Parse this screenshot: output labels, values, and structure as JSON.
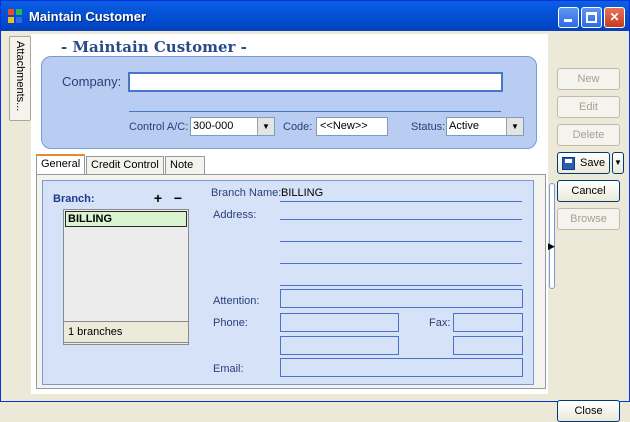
{
  "window": {
    "title": "Maintain Customer"
  },
  "side_tab": {
    "label": "Attachments..."
  },
  "form": {
    "heading": "- Maintain Customer -",
    "company_label": "Company:",
    "company_value": "",
    "control_ac_label": "Control A/C:",
    "control_ac_value": "300-000",
    "code_label": "Code:",
    "code_value": "<<New>>",
    "status_label": "Status:",
    "status_value": "Active"
  },
  "tabs": [
    {
      "label": "General",
      "active": true
    },
    {
      "label": "Credit Control",
      "active": false
    },
    {
      "label": "Note",
      "active": false
    }
  ],
  "branch": {
    "label": "Branch:",
    "add_symbol": "+",
    "remove_symbol": "−",
    "items": [
      "BILLING"
    ],
    "count_text": "1 branches"
  },
  "details": {
    "branch_name_label": "Branch Name:",
    "branch_name_value": "BILLING",
    "address_label": "Address:",
    "attention_label": "Attention:",
    "phone_label": "Phone:",
    "fax_label": "Fax:",
    "email_label": "Email:"
  },
  "toolbar": {
    "new_label": "New",
    "edit_label": "Edit",
    "delete_label": "Delete",
    "save_label": "Save",
    "cancel_label": "Cancel",
    "browse_label": "Browse",
    "close_label": "Close"
  },
  "icons": {
    "app": "app-icon",
    "minimize": "minimize-icon",
    "maximize": "maximize-icon",
    "close": "close-icon",
    "save": "floppy-disk-icon",
    "dropdown": "chevron-down-icon"
  }
}
